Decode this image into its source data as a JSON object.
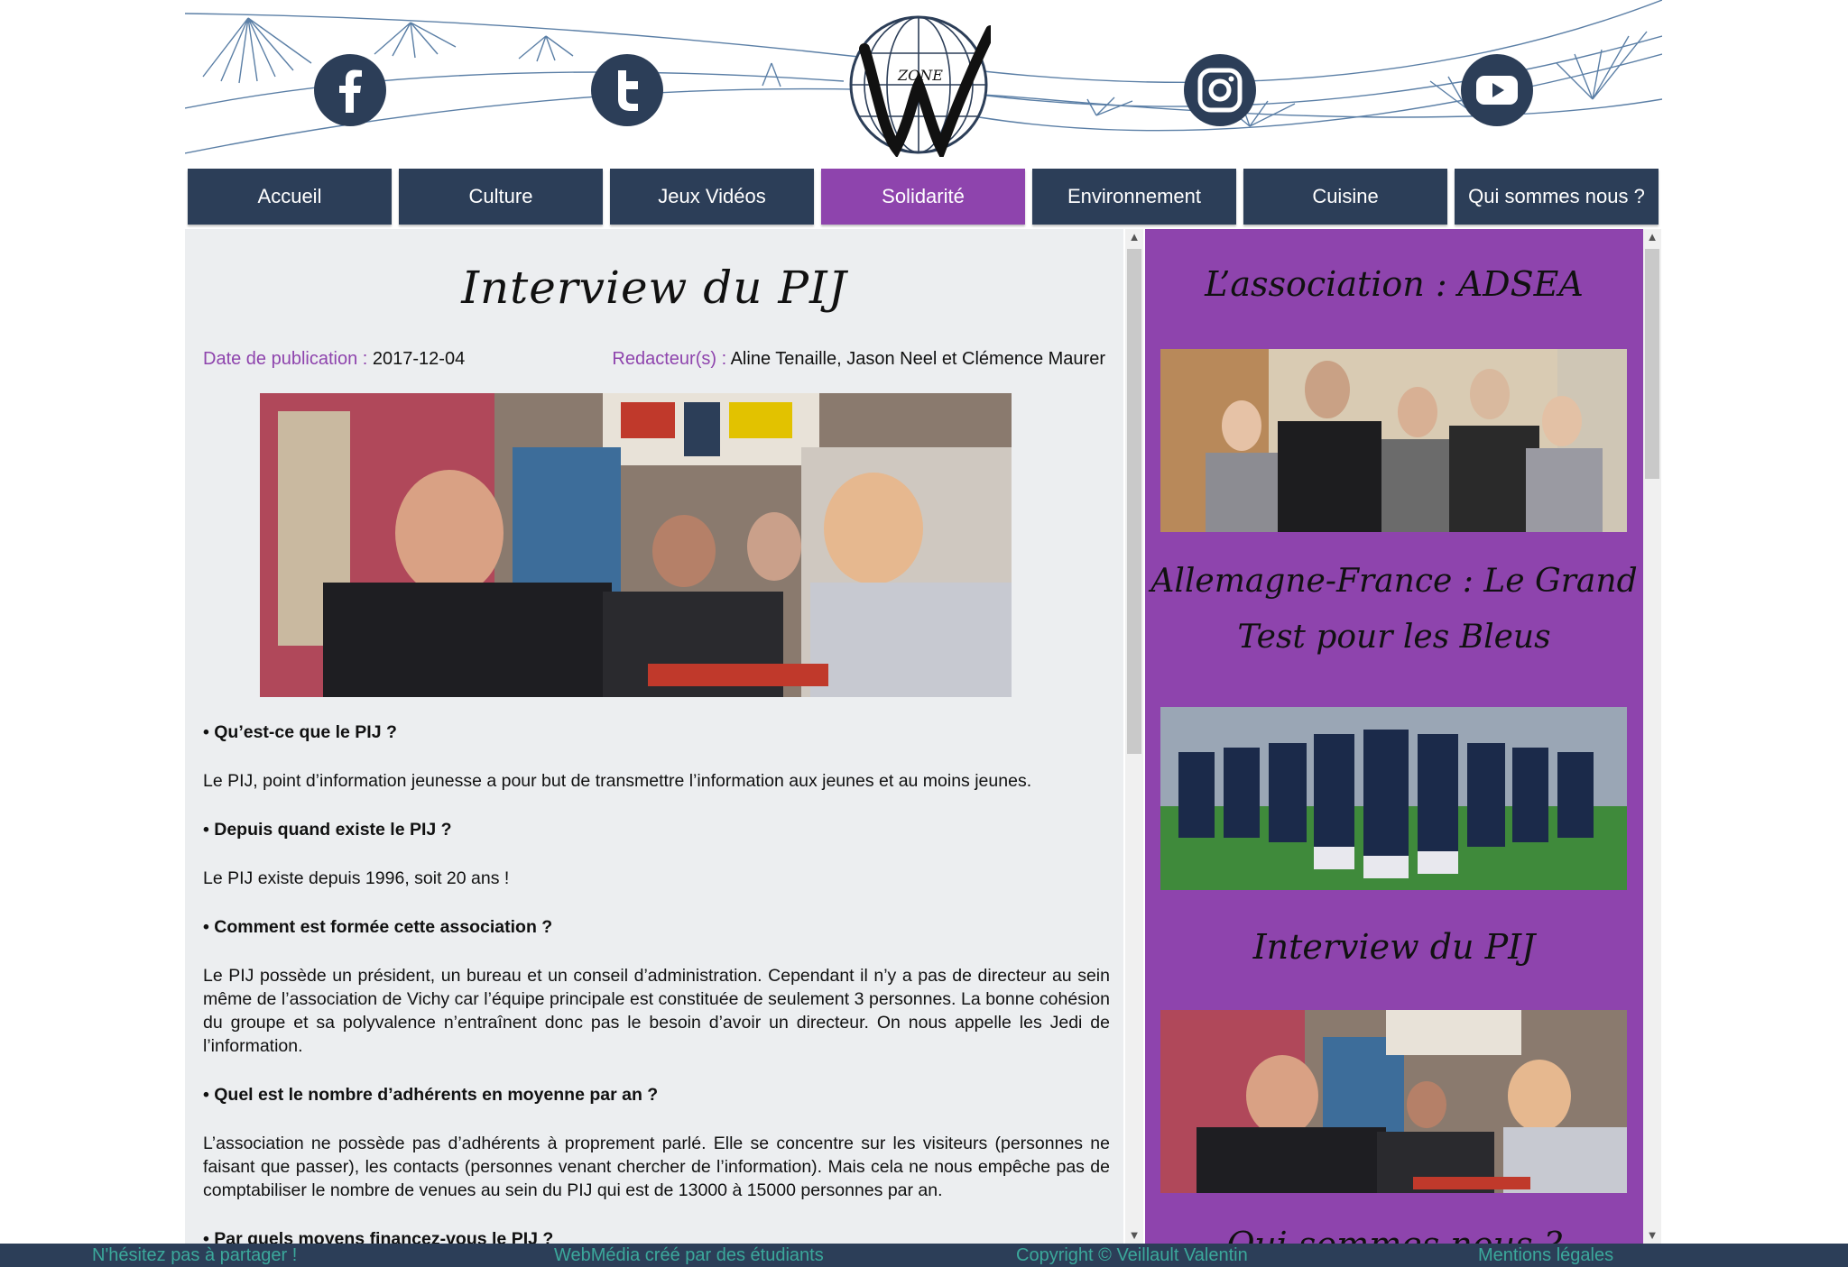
{
  "header": {
    "logo_text": "ZONE",
    "social": [
      "facebook-icon",
      "twitter-icon",
      "instagram-icon",
      "youtube-icon"
    ]
  },
  "nav": {
    "items": [
      {
        "label": "Accueil"
      },
      {
        "label": "Culture"
      },
      {
        "label": "Jeux Vidéos"
      },
      {
        "label": "Solidarité"
      },
      {
        "label": "Environnement"
      },
      {
        "label": "Cuisine"
      },
      {
        "label": "Qui sommes nous ?"
      }
    ],
    "active": "Solidarité"
  },
  "article": {
    "title": "Interview du PIJ",
    "date_label": "Date de publication :",
    "date": "2017-12-04",
    "authors_label": "Redacteur(s) :",
    "authors": "Aline Tenaille, Jason Neel et Clémence Maurer",
    "sections": [
      {
        "q": "• Qu’est-ce que le PIJ ?",
        "a": "Le PIJ, point d’information jeunesse a pour but de transmettre l’information aux jeunes et au moins jeunes."
      },
      {
        "q": "• Depuis quand existe le PIJ ?",
        "a": "Le PIJ existe depuis 1996, soit 20 ans !"
      },
      {
        "q": "• Comment est formée cette association ?",
        "a": "Le PIJ possède un président, un bureau et un conseil d’administration. Cependant il n’y a pas de directeur au sein même de l’association de Vichy car l’équipe principale est constituée de seulement 3 personnes. La bonne cohésion du groupe et sa polyvalence n’entraînent donc pas le besoin d’avoir un directeur. On nous appelle les Jedi de l’information."
      },
      {
        "q": "• Quel est le nombre d’adhérents en moyenne par an ?",
        "a": "L’association ne possède pas d’adhérents à proprement parlé. Elle se concentre sur les visiteurs (personnes ne faisant que passer), les contacts (personnes venant chercher de l’information). Mais cela ne nous empêche pas de comptabiliser le nombre de venues au sein du PIJ qui est de 13000 à 15000 personnes par an."
      },
      {
        "q": "• Par quels moyens financez-vous le PIJ ?",
        "a": ""
      }
    ]
  },
  "sidebar": {
    "items": [
      {
        "title": "L’association : ADSEA"
      },
      {
        "title": "Allemagne-France : Le Grand Test pour les Bleus"
      },
      {
        "title": "Interview du PIJ"
      },
      {
        "title": "Qui sommes nous ?"
      }
    ]
  },
  "footer": {
    "share": "N'hésitez pas à partager !",
    "made_by": "WebMédia créé par des étudiants",
    "copyright": "Copyright © Veillault Valentin",
    "legal": "Mentions légales"
  },
  "colors": {
    "navy": "#2c3e58",
    "purple": "#8e44ad",
    "footer_text": "#3ba89b",
    "content_bg": "#eceef0"
  }
}
